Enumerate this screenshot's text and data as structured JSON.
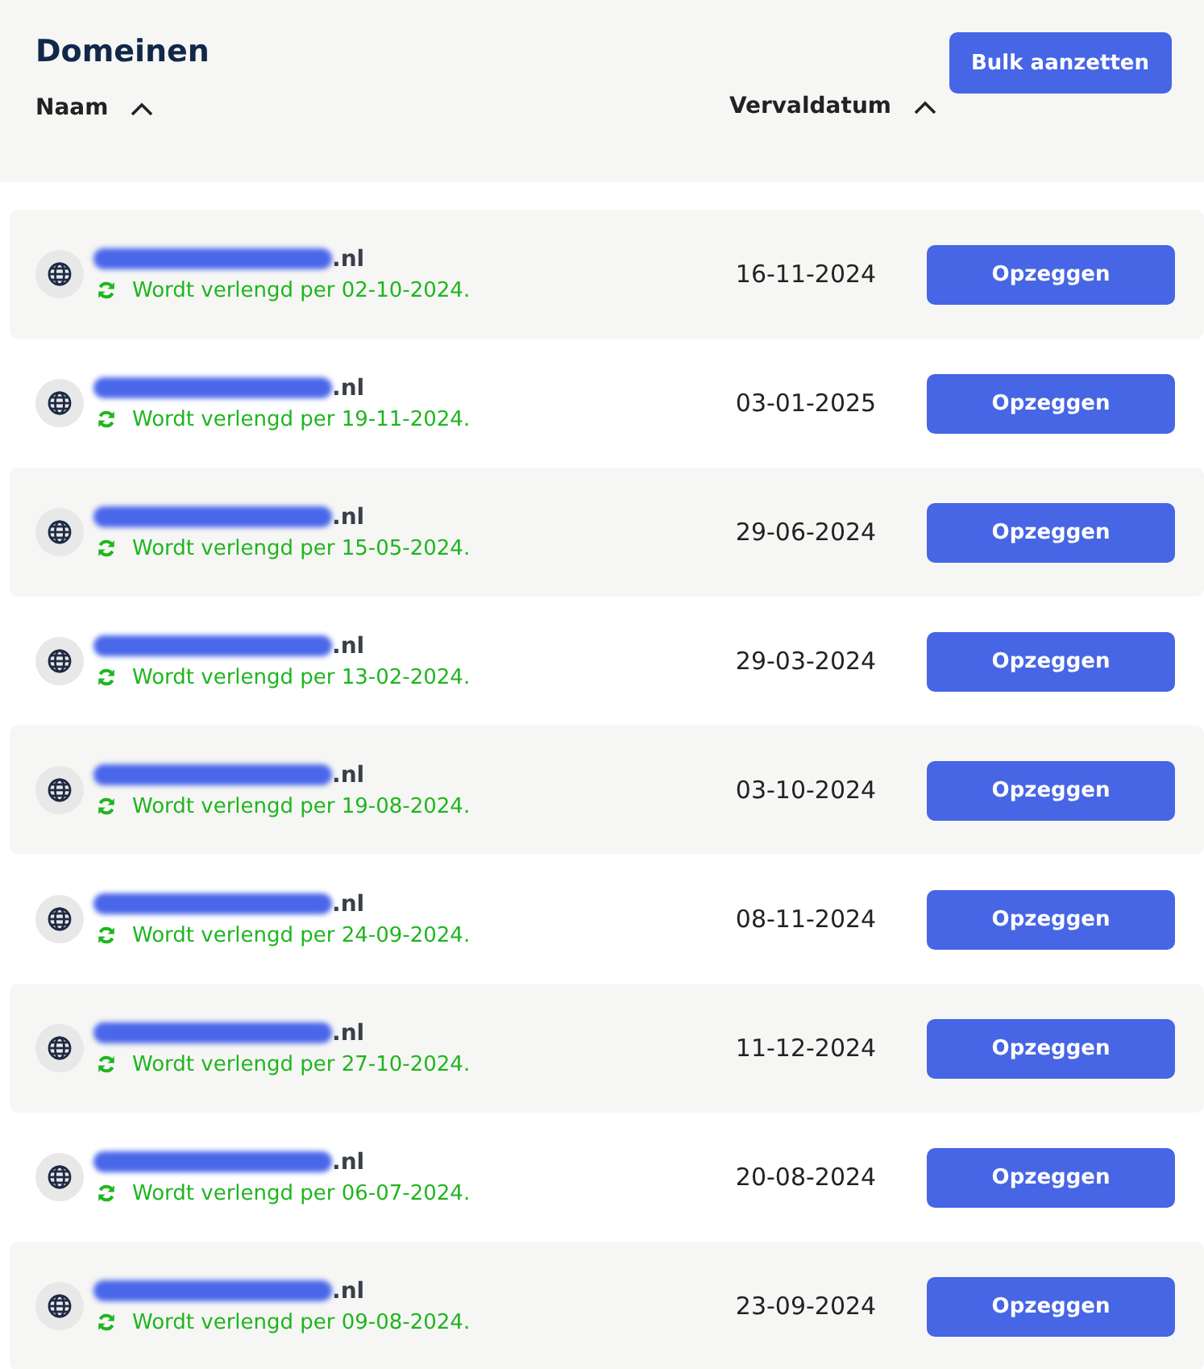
{
  "title": "Domeinen",
  "bulk_button": "Bulk aanzetten",
  "columns": [
    {
      "label": "Naam"
    },
    {
      "label": "Vervaldatum"
    }
  ],
  "rows": [
    {
      "domain": ".nl",
      "renewal": "Wordt verlengd per 02-10-2024.",
      "expiry": "16-11-2024",
      "action": "Opzeggen"
    },
    {
      "domain": ".nl",
      "renewal": "Wordt verlengd per 19-11-2024.",
      "expiry": "03-01-2025",
      "action": "Opzeggen"
    },
    {
      "domain": ".nl",
      "renewal": "Wordt verlengd per 15-05-2024.",
      "expiry": "29-06-2024",
      "action": "Opzeggen"
    },
    {
      "domain": ".nl",
      "renewal": "Wordt verlengd per 13-02-2024.",
      "expiry": "29-03-2024",
      "action": "Opzeggen"
    },
    {
      "domain": ".nl",
      "renewal": "Wordt verlengd per 19-08-2024.",
      "expiry": "03-10-2024",
      "action": "Opzeggen"
    },
    {
      "domain": ".nl",
      "renewal": "Wordt verlengd per 24-09-2024.",
      "expiry": "08-11-2024",
      "action": "Opzeggen"
    },
    {
      "domain": ".nl",
      "renewal": "Wordt verlengd per 27-10-2024.",
      "expiry": "11-12-2024",
      "action": "Opzeggen"
    },
    {
      "domain": ".nl",
      "renewal": "Wordt verlengd per 06-07-2024.",
      "expiry": "20-08-2024",
      "action": "Opzeggen"
    },
    {
      "domain": ".nl",
      "renewal": "Wordt verlengd per 09-08-2024.",
      "expiry": "23-09-2024",
      "action": "Opzeggen"
    }
  ]
}
